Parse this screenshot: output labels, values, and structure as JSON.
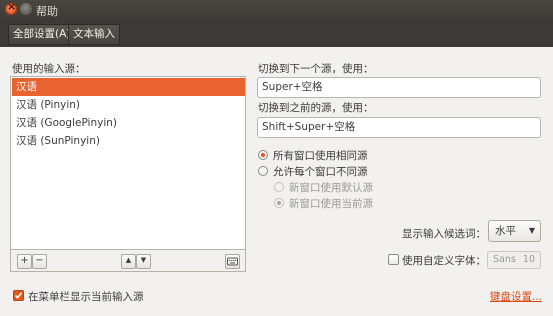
{
  "window": {
    "title": "帮助"
  },
  "toolbar": {
    "all_settings": "全部设置(A)",
    "text_input": "文本输入"
  },
  "sources": {
    "label": "使用的输入源：",
    "items": [
      "汉语",
      "汉语 (Pinyin)",
      "汉语 (GooglePinyin)",
      "汉语 (SunPinyin)"
    ],
    "add": "+",
    "remove": "−",
    "up": "▲",
    "down": "▼"
  },
  "switch_next": {
    "label": "切换到下一个源，使用：",
    "value": "Super+空格"
  },
  "switch_prev": {
    "label": "切换到之前的源，使用：",
    "value": "Shift+Super+空格"
  },
  "radios": {
    "same_source": "所有窗口使用相同源",
    "different_source": "允许每个窗口不同源",
    "new_window_default": "新窗口使用默认源",
    "new_window_current": "新窗口使用当前源"
  },
  "candidates": {
    "label": "显示输入候选词：",
    "value": "水平"
  },
  "custom_font": {
    "label": "使用自定义字体：",
    "font_name": "Sans",
    "font_size": "10"
  },
  "show_in_menu": {
    "label": "在菜单栏显示当前输入源",
    "checked": true
  },
  "keyboard_settings": "键盘设置...",
  "colors": {
    "accent": "#e8632f",
    "titlebar": "#3c3b37",
    "link": "#dd4814"
  }
}
